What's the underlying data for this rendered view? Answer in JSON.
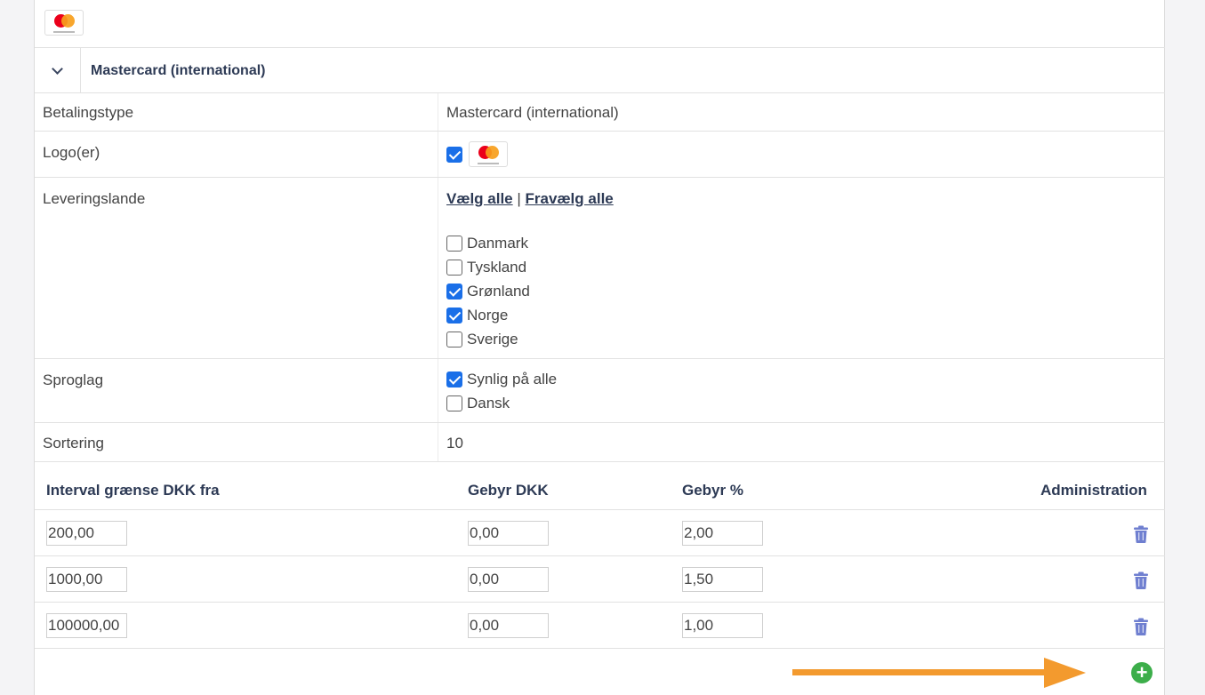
{
  "section": {
    "title": "Mastercard (international)"
  },
  "rows": {
    "payment_type": {
      "label": "Betalingstype",
      "value": "Mastercard (international)"
    },
    "logos": {
      "label": "Logo(er)",
      "checked": true
    },
    "countries": {
      "label": "Leveringslande",
      "select_all": "Vælg alle",
      "separator": "|",
      "deselect_all": "Fravælg alle",
      "items": [
        {
          "name": "Danmark",
          "checked": false
        },
        {
          "name": "Tyskland",
          "checked": false
        },
        {
          "name": "Grønland",
          "checked": true
        },
        {
          "name": "Norge",
          "checked": true
        },
        {
          "name": "Sverige",
          "checked": false
        }
      ]
    },
    "languages": {
      "label": "Sproglag",
      "items": [
        {
          "name": "Synlig på alle",
          "checked": true
        },
        {
          "name": "Dansk",
          "checked": false
        }
      ]
    },
    "sorting": {
      "label": "Sortering",
      "value": "10"
    }
  },
  "fee_table": {
    "headers": [
      "Interval grænse DKK fra",
      "Gebyr DKK",
      "Gebyr %",
      "Administration"
    ],
    "rows": [
      {
        "from": "200,00",
        "fee_dkk": "0,00",
        "fee_pct": "2,00"
      },
      {
        "from": "1000,00",
        "fee_dkk": "0,00",
        "fee_pct": "1,50"
      },
      {
        "from": "100000,00",
        "fee_dkk": "0,00",
        "fee_pct": "1,00"
      }
    ]
  },
  "icons": {
    "logo": "mastercard-logo",
    "collapse": "chevron-down-icon",
    "delete": "trash-icon",
    "add": "plus-circle-icon",
    "annotation": "orange-arrow"
  },
  "colors": {
    "accent": "#1a6fe8",
    "heading": "#2d3a55",
    "trash": "#6f7fd0",
    "add": "#3cae4a",
    "arrow": "#f39a2e"
  }
}
